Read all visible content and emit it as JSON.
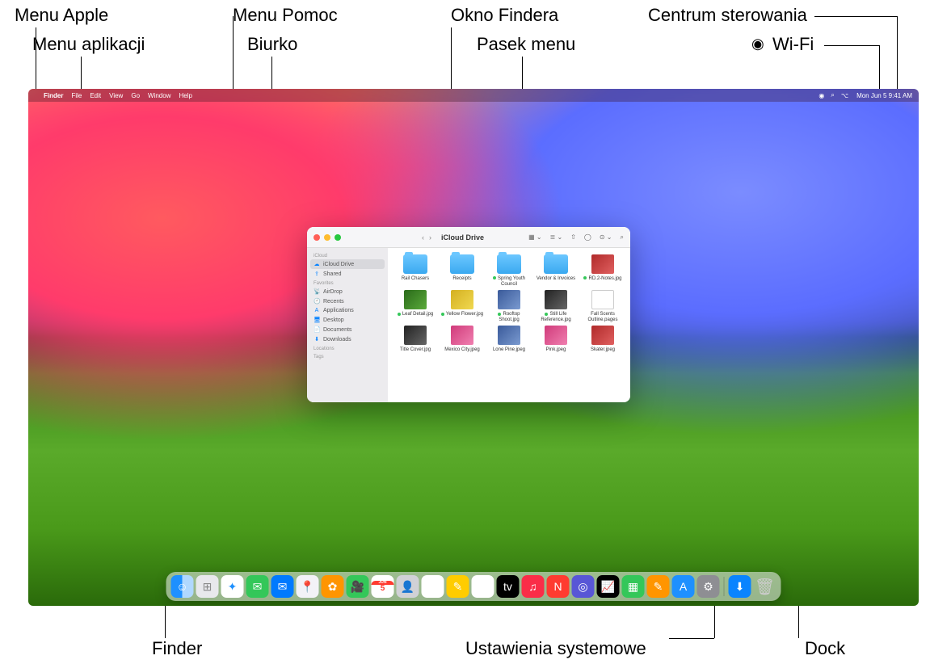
{
  "callouts": {
    "apple_menu": "Menu Apple",
    "app_menu": "Menu aplikacji",
    "help_menu": "Menu Pomoc",
    "desktop": "Biurko",
    "finder_window": "Okno Findera",
    "menu_bar": "Pasek menu",
    "control_center": "Centrum sterowania",
    "wifi": "Wi-Fi",
    "finder": "Finder",
    "system_settings": "Ustawienia systemowe",
    "dock": "Dock"
  },
  "menubar": {
    "app": "Finder",
    "items": [
      "File",
      "Edit",
      "View",
      "Go",
      "Window",
      "Help"
    ],
    "clock": "Mon Jun 5  9:41 AM"
  },
  "finder": {
    "title": "iCloud Drive",
    "sidebar": {
      "icloud_head": "iCloud",
      "icloud_items": [
        {
          "icon": "☁︎",
          "label": "iCloud Drive",
          "sel": true
        },
        {
          "icon": "⇪",
          "label": "Shared",
          "sel": false
        }
      ],
      "fav_head": "Favorites",
      "fav_items": [
        {
          "icon": "📡",
          "label": "AirDrop"
        },
        {
          "icon": "🕘",
          "label": "Recents"
        },
        {
          "icon": "A",
          "label": "Applications"
        },
        {
          "icon": "🖥",
          "label": "Desktop"
        },
        {
          "icon": "📄",
          "label": "Documents"
        },
        {
          "icon": "⬇︎",
          "label": "Downloads"
        }
      ],
      "loc_head": "Locations",
      "tags_head": "Tags"
    },
    "files": [
      {
        "kind": "folder",
        "label": "Rail Chasers",
        "dot": false
      },
      {
        "kind": "folder",
        "label": "Receipts",
        "dot": false
      },
      {
        "kind": "folder",
        "label": "Spring Youth Council",
        "dot": true
      },
      {
        "kind": "folder",
        "label": "Vendor & Invoices",
        "dot": false
      },
      {
        "kind": "thumb",
        "cls": "red",
        "label": "RD.2-Notes.jpg",
        "dot": true
      },
      {
        "kind": "thumb",
        "cls": "green",
        "label": "Leaf Detail.jpg",
        "dot": true
      },
      {
        "kind": "thumb",
        "cls": "yellow",
        "label": "Yellow Flower.jpg",
        "dot": true
      },
      {
        "kind": "thumb",
        "cls": "blue",
        "label": "Rooftop Shoot.jpg",
        "dot": true
      },
      {
        "kind": "thumb",
        "cls": "bw",
        "label": "Still Life Reference.jpg",
        "dot": true
      },
      {
        "kind": "thumb",
        "cls": "doc",
        "label": "Fall Scents Outline.pages",
        "dot": false
      },
      {
        "kind": "thumb",
        "cls": "bw",
        "label": "Title Cover.jpg",
        "dot": false
      },
      {
        "kind": "thumb",
        "cls": "pink",
        "label": "Mexico City.jpeg",
        "dot": false
      },
      {
        "kind": "thumb",
        "cls": "blue",
        "label": "Lone Pine.jpeg",
        "dot": false
      },
      {
        "kind": "thumb",
        "cls": "pink",
        "label": "Pink.jpeg",
        "dot": false
      },
      {
        "kind": "thumb",
        "cls": "red",
        "label": "Skater.jpeg",
        "dot": false
      }
    ]
  },
  "dock": {
    "cal_month": "JUN",
    "cal_day": "5",
    "icons": [
      {
        "name": "finder",
        "cls": "di-finder",
        "glyph": "☺"
      },
      {
        "name": "launchpad",
        "cls": "di-launchpad",
        "glyph": "⊞"
      },
      {
        "name": "safari",
        "cls": "di-safari",
        "glyph": "✦"
      },
      {
        "name": "messages",
        "cls": "di-green",
        "glyph": "✉"
      },
      {
        "name": "mail",
        "cls": "di-blue",
        "glyph": "✉"
      },
      {
        "name": "maps",
        "cls": "di-maps",
        "glyph": "📍"
      },
      {
        "name": "photos",
        "cls": "di-orange",
        "glyph": "✿"
      },
      {
        "name": "facetime",
        "cls": "di-ft",
        "glyph": "🎥"
      },
      {
        "name": "calendar",
        "cls": "di-cal",
        "glyph": ""
      },
      {
        "name": "contacts",
        "cls": "di-contacts",
        "glyph": "👤"
      },
      {
        "name": "reminders",
        "cls": "di-reminders",
        "glyph": "☰"
      },
      {
        "name": "notes",
        "cls": "di-notes",
        "glyph": "✎"
      },
      {
        "name": "freeform",
        "cls": "di-freeform",
        "glyph": "〰"
      },
      {
        "name": "tv",
        "cls": "di-tv",
        "glyph": "tv"
      },
      {
        "name": "music",
        "cls": "di-music",
        "glyph": "♫"
      },
      {
        "name": "news",
        "cls": "di-news",
        "glyph": "N"
      },
      {
        "name": "podcasts",
        "cls": "di-purple",
        "glyph": "◎"
      },
      {
        "name": "stocks",
        "cls": "di-stocks",
        "glyph": "📈"
      },
      {
        "name": "numbers",
        "cls": "di-numbers",
        "glyph": "▦"
      },
      {
        "name": "pages",
        "cls": "di-pages",
        "glyph": "✎"
      },
      {
        "name": "appstore",
        "cls": "di-appstore",
        "glyph": "A"
      },
      {
        "name": "settings",
        "cls": "di-settings",
        "glyph": "⚙"
      }
    ],
    "right": [
      {
        "name": "downloads",
        "cls": "di-downloads",
        "glyph": "⬇"
      },
      {
        "name": "trash",
        "cls": "di-trash",
        "glyph": "🗑"
      }
    ]
  }
}
